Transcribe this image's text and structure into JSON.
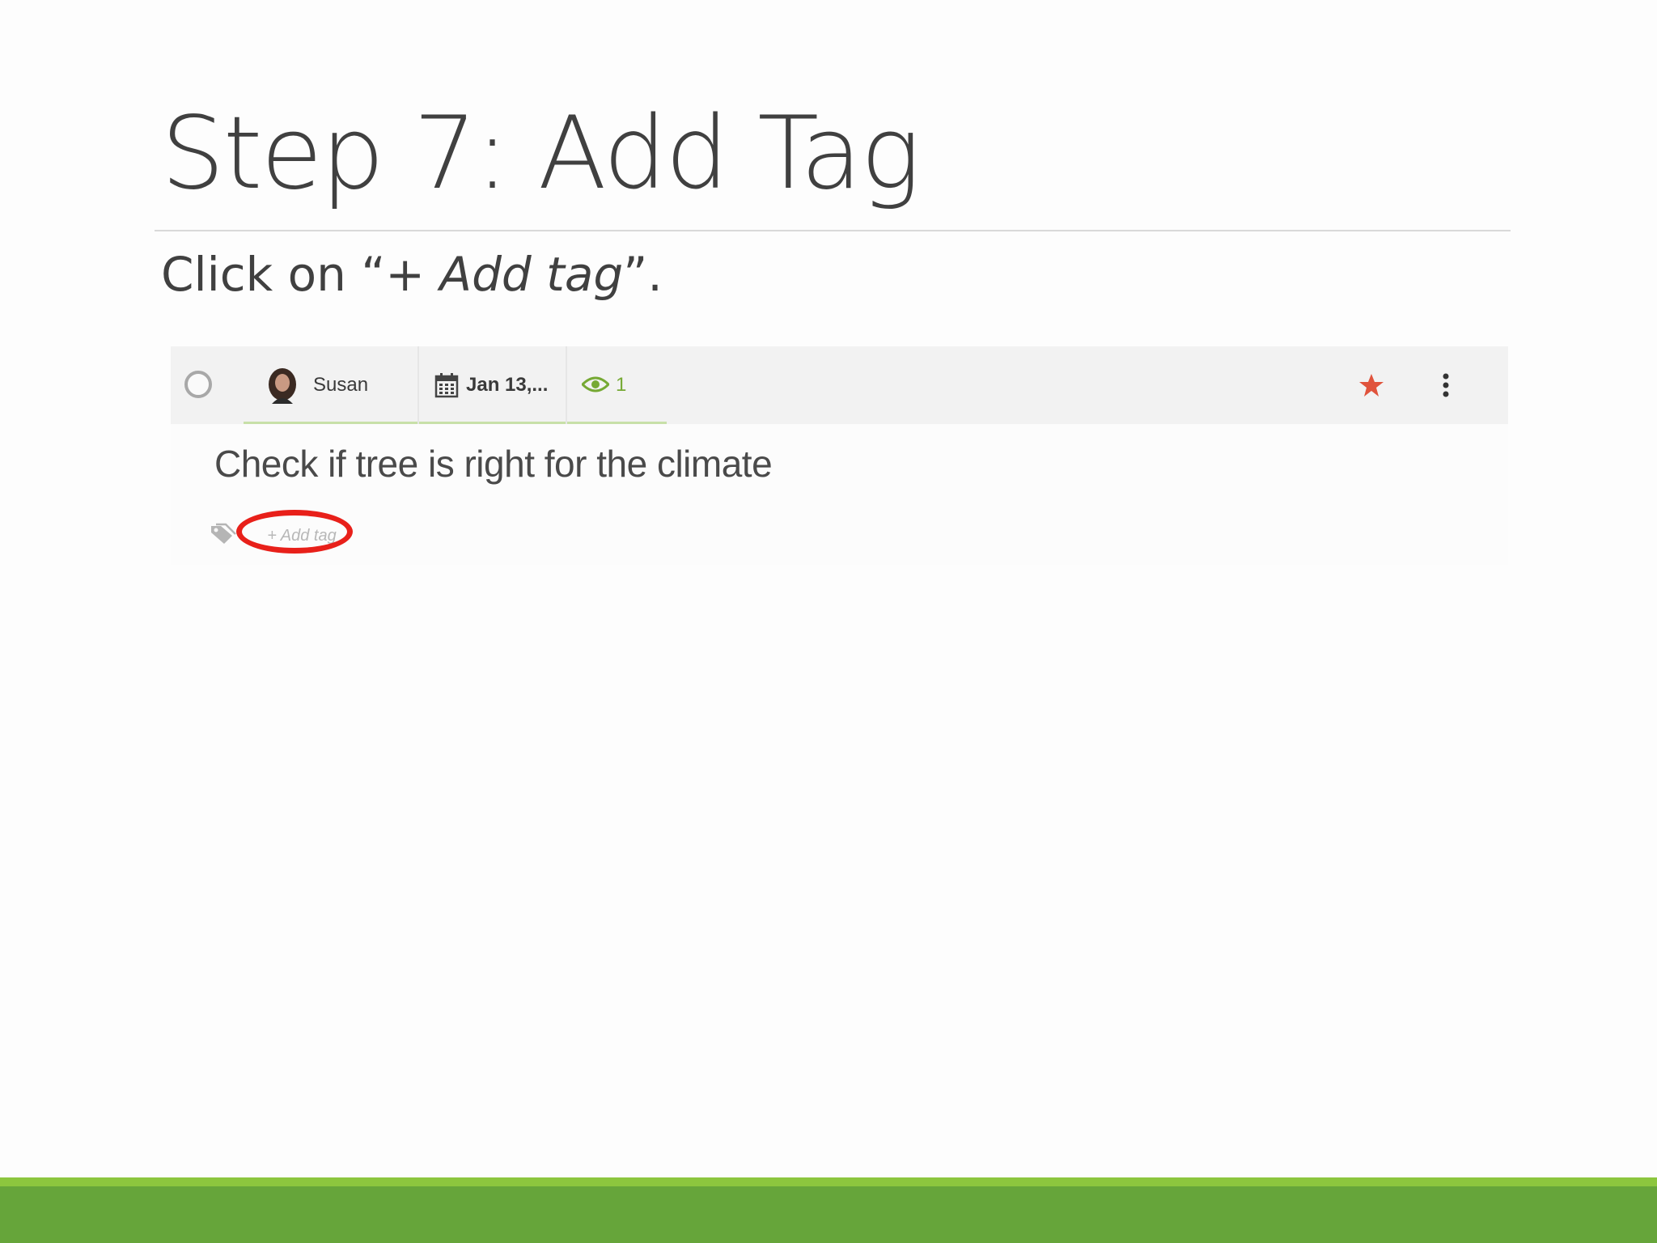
{
  "slide": {
    "title": "Step 7: Add Tag",
    "instruction_prefix": "Click on “+ ",
    "instruction_emphasis": "Add tag",
    "instruction_suffix": "”."
  },
  "task_card": {
    "assignee": "Susan",
    "due_date": "Jan 13,...",
    "watchers_count": "1",
    "title": "Check if tree is right for the climate",
    "add_tag_label": "+ Add tag",
    "starred": true
  },
  "colors": {
    "title_text": "#404040",
    "accent_green": "#66a53a",
    "accent_green_light": "#8cc63e",
    "star": "#e0533c",
    "highlight": "#e8201a",
    "watchers": "#76a934"
  },
  "icons": [
    "complete-circle-icon",
    "avatar",
    "calendar-icon",
    "eye-icon",
    "star-icon",
    "more-vertical-icon",
    "tag-icon"
  ]
}
